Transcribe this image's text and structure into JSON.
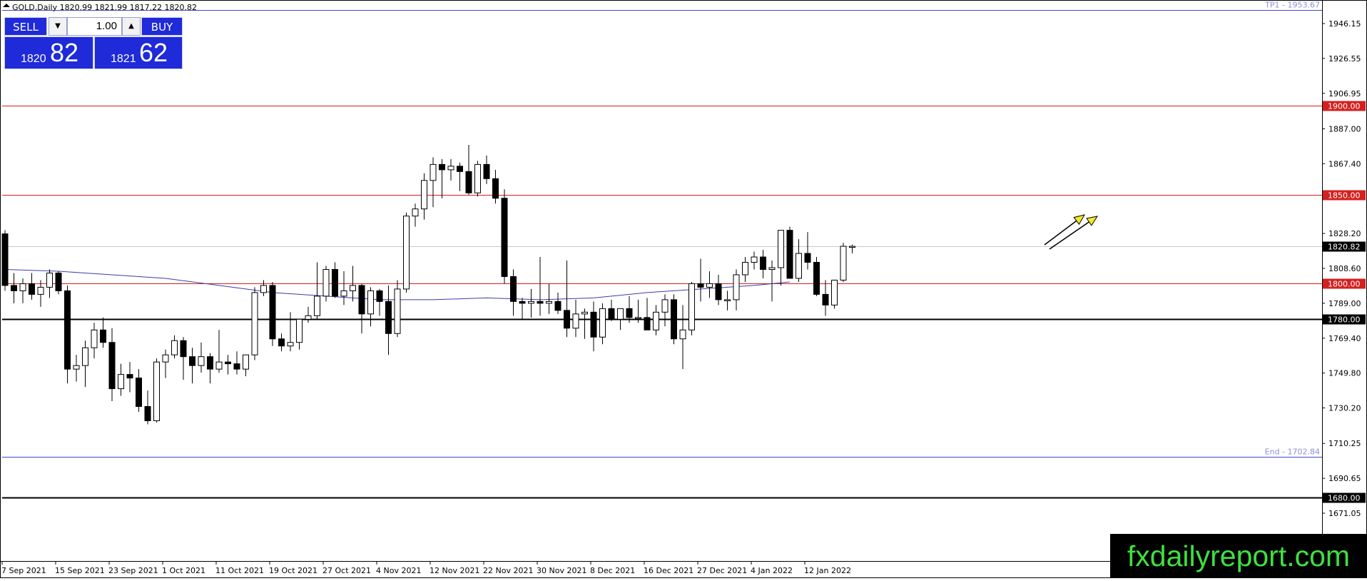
{
  "chart_data": {
    "type": "candlestick",
    "symbol_line": "GOLD,Daily  1820.99 1821.99 1817.22 1820.82",
    "y_axis": {
      "ticks": [
        "1946.15",
        "1926.55",
        "1906.95",
        "1887.00",
        "1867.40",
        "1828.20",
        "1808.60",
        "1789.00",
        "1769.40",
        "1749.80",
        "1730.20",
        "1710.25",
        "1690.65",
        "1671.05"
      ],
      "range": [
        1660,
        1960
      ]
    },
    "x_axis": {
      "ticks": [
        {
          "label": "7 Sep 2021",
          "index": 0
        },
        {
          "label": "15 Sep 2021",
          "index": 6
        },
        {
          "label": "23 Sep 2021",
          "index": 12
        },
        {
          "label": "1 Oct 2021",
          "index": 18
        },
        {
          "label": "11 Oct 2021",
          "index": 24
        },
        {
          "label": "19 Oct 2021",
          "index": 30
        },
        {
          "label": "27 Oct 2021",
          "index": 36
        },
        {
          "label": "4 Nov 2021",
          "index": 42
        },
        {
          "label": "12 Nov 2021",
          "index": 48
        },
        {
          "label": "22 Nov 2021",
          "index": 54
        },
        {
          "label": "30 Nov 2021",
          "index": 60
        },
        {
          "label": "8 Dec 2021",
          "index": 66
        },
        {
          "label": "16 Dec 2021",
          "index": 72
        },
        {
          "label": "27 Dec 2021",
          "index": 78
        },
        {
          "label": "4 Jan 2022",
          "index": 84
        },
        {
          "label": "12 Jan 2022",
          "index": 90
        }
      ]
    },
    "horizontal_levels": [
      {
        "value": 1953.67,
        "color": "#4646c8",
        "width": 1,
        "label": "TP1 - 1953.67",
        "label_color": "#8f8fd8"
      },
      {
        "value": 1900.0,
        "color": "#d42020",
        "width": 1,
        "tag": "1900.00",
        "tag_color": "#d42020"
      },
      {
        "value": 1850.0,
        "color": "#d42020",
        "width": 1,
        "tag": "1850.00",
        "tag_color": "#d42020"
      },
      {
        "value": 1800.0,
        "color": "#d42020",
        "width": 1,
        "tag": "1800.00",
        "tag_color": "#d42020"
      },
      {
        "value": 1780.0,
        "color": "#000000",
        "width": 2,
        "tag": "1780.00",
        "tag_color": "#000000"
      },
      {
        "value": 1702.84,
        "color": "#4646c8",
        "width": 1,
        "label": "End - 1702.84",
        "label_color": "#8f8fd8"
      },
      {
        "value": 1680.0,
        "color": "#000000",
        "width": 2,
        "tag": "1680.00",
        "tag_color": "#000000"
      }
    ],
    "current_price": {
      "value": 1820.82,
      "tag": "1820.82"
    },
    "moving_average": {
      "color": "#3c3caa",
      "points": [
        [
          0,
          1808
        ],
        [
          6,
          1807
        ],
        [
          12,
          1805
        ],
        [
          18,
          1803
        ],
        [
          24,
          1799
        ],
        [
          30,
          1795
        ],
        [
          36,
          1793
        ],
        [
          42,
          1791
        ],
        [
          48,
          1791
        ],
        [
          54,
          1792
        ],
        [
          60,
          1791
        ],
        [
          66,
          1792
        ],
        [
          72,
          1795
        ],
        [
          78,
          1797
        ],
        [
          84,
          1799
        ],
        [
          88,
          1801
        ]
      ]
    },
    "candles": [
      [
        1828,
        1830,
        1796,
        1799
      ],
      [
        1799,
        1806,
        1789,
        1796
      ],
      [
        1796,
        1803,
        1789,
        1800
      ],
      [
        1800,
        1806,
        1791,
        1794
      ],
      [
        1794,
        1802,
        1787,
        1798
      ],
      [
        1798,
        1808,
        1792,
        1806
      ],
      [
        1806,
        1807,
        1794,
        1796
      ],
      [
        1796,
        1799,
        1744,
        1752
      ],
      [
        1752,
        1760,
        1745,
        1754
      ],
      [
        1754,
        1768,
        1742,
        1764
      ],
      [
        1764,
        1778,
        1758,
        1774
      ],
      [
        1774,
        1781,
        1764,
        1767
      ],
      [
        1767,
        1775,
        1734,
        1741
      ],
      [
        1741,
        1755,
        1737,
        1749
      ],
      [
        1749,
        1756,
        1739,
        1747
      ],
      [
        1747,
        1752,
        1728,
        1731
      ],
      [
        1731,
        1740,
        1721,
        1723
      ],
      [
        1723,
        1758,
        1722,
        1756
      ],
      [
        1756,
        1763,
        1747,
        1760
      ],
      [
        1760,
        1771,
        1758,
        1768
      ],
      [
        1768,
        1770,
        1746,
        1759
      ],
      [
        1759,
        1764,
        1744,
        1754
      ],
      [
        1754,
        1767,
        1750,
        1759
      ],
      [
        1759,
        1761,
        1744,
        1752
      ],
      [
        1752,
        1774,
        1750,
        1756
      ],
      [
        1756,
        1760,
        1749,
        1755
      ],
      [
        1755,
        1762,
        1749,
        1752
      ],
      [
        1752,
        1760,
        1748,
        1760
      ],
      [
        1760,
        1798,
        1757,
        1795
      ],
      [
        1795,
        1802,
        1793,
        1799
      ],
      [
        1799,
        1801,
        1765,
        1769
      ],
      [
        1769,
        1772,
        1762,
        1765
      ],
      [
        1765,
        1784,
        1762,
        1767
      ],
      [
        1767,
        1779,
        1763,
        1780
      ],
      [
        1780,
        1787,
        1778,
        1782
      ],
      [
        1782,
        1812,
        1780,
        1793
      ],
      [
        1793,
        1810,
        1790,
        1808
      ],
      [
        1808,
        1812,
        1792,
        1793
      ],
      [
        1793,
        1807,
        1788,
        1796
      ],
      [
        1796,
        1810,
        1790,
        1799
      ],
      [
        1799,
        1800,
        1772,
        1783
      ],
      [
        1783,
        1798,
        1776,
        1796
      ],
      [
        1796,
        1797,
        1782,
        1790
      ],
      [
        1790,
        1799,
        1760,
        1772
      ],
      [
        1772,
        1802,
        1770,
        1797
      ],
      [
        1797,
        1840,
        1795,
        1838
      ],
      [
        1838,
        1845,
        1832,
        1842
      ],
      [
        1842,
        1862,
        1836,
        1858
      ],
      [
        1858,
        1871,
        1843,
        1867
      ],
      [
        1867,
        1870,
        1848,
        1864
      ],
      [
        1864,
        1870,
        1858,
        1866
      ],
      [
        1866,
        1868,
        1852,
        1863
      ],
      [
        1863,
        1878,
        1850,
        1851
      ],
      [
        1851,
        1869,
        1849,
        1867
      ],
      [
        1867,
        1872,
        1856,
        1859
      ],
      [
        1859,
        1864,
        1845,
        1848
      ],
      [
        1848,
        1853,
        1800,
        1804
      ],
      [
        1804,
        1808,
        1782,
        1790
      ],
      [
        1790,
        1792,
        1780,
        1789
      ],
      [
        1789,
        1797,
        1781,
        1790
      ],
      [
        1790,
        1815,
        1782,
        1789
      ],
      [
        1789,
        1800,
        1783,
        1790
      ],
      [
        1790,
        1795,
        1783,
        1785
      ],
      [
        1785,
        1813,
        1770,
        1775
      ],
      [
        1775,
        1791,
        1770,
        1783
      ],
      [
        1783,
        1786,
        1769,
        1784
      ],
      [
        1784,
        1790,
        1762,
        1770
      ],
      [
        1770,
        1789,
        1766,
        1786
      ],
      [
        1786,
        1791,
        1779,
        1780
      ],
      [
        1780,
        1786,
        1774,
        1786
      ],
      [
        1786,
        1793,
        1778,
        1781
      ],
      [
        1781,
        1791,
        1778,
        1781
      ],
      [
        1781,
        1792,
        1775,
        1774
      ],
      [
        1774,
        1788,
        1771,
        1784
      ],
      [
        1784,
        1794,
        1776,
        1791
      ],
      [
        1791,
        1794,
        1766,
        1769
      ],
      [
        1769,
        1788,
        1752,
        1774
      ],
      [
        1774,
        1801,
        1771,
        1800
      ],
      [
        1800,
        1814,
        1790,
        1798
      ],
      [
        1798,
        1807,
        1792,
        1800
      ],
      [
        1800,
        1805,
        1788,
        1791
      ],
      [
        1791,
        1796,
        1785,
        1791
      ],
      [
        1791,
        1808,
        1785,
        1805
      ],
      [
        1805,
        1815,
        1801,
        1812
      ],
      [
        1812,
        1818,
        1808,
        1815
      ],
      [
        1815,
        1819,
        1803,
        1808
      ],
      [
        1808,
        1813,
        1790,
        1809
      ],
      [
        1809,
        1822,
        1799,
        1830
      ],
      [
        1830,
        1832,
        1808,
        1803
      ],
      [
        1803,
        1825,
        1801,
        1817
      ],
      [
        1817,
        1829,
        1808,
        1812
      ],
      [
        1812,
        1815,
        1793,
        1794
      ],
      [
        1794,
        1802,
        1782,
        1788
      ],
      [
        1788,
        1802,
        1786,
        1802
      ],
      [
        1802,
        1823,
        1801,
        1821
      ],
      [
        1821,
        1822,
        1817,
        1821
      ]
    ],
    "arrows": [
      {
        "from": [
          1464,
          343
        ],
        "to": [
          1520,
          301
        ]
      },
      {
        "from": [
          1471,
          349
        ],
        "to": [
          1538,
          303
        ]
      }
    ]
  },
  "trade_panel": {
    "sell_label": "SELL",
    "buy_label": "BUY",
    "lot": "1.00",
    "dec_symbol": "▼",
    "inc_symbol": "▲",
    "sell_price_small": "1820",
    "sell_price_big": "82",
    "buy_price_small": "1821",
    "buy_price_big": "62"
  },
  "watermark": "fxdailyreport.com"
}
